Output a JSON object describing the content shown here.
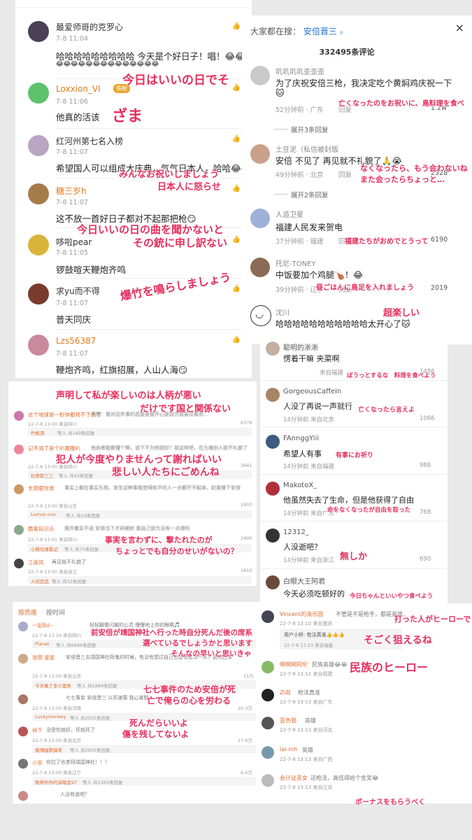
{
  "p1": {
    "comments": [
      {
        "name": "最爱师哥的克罗心",
        "time": "7-8 11:04",
        "body": "哈哈哈哈哈哈哈哈哈 今天是个好日子！唱！😂😂😂",
        "body2": "😂😂😂😂😂😂😂😂😂😂😂😂😂😂",
        "name_color": "#333"
      },
      {
        "name": "Loxxion_VI",
        "badge": "铁粉",
        "time": "7-8 11:06",
        "body": "他真的活该",
        "name_color": "#e07a1f"
      },
      {
        "name": "红河州第七名入榜",
        "time": "7-8 11:07",
        "body": "希望国人可以组成大庆典，气气日本人，哈哈😂😂",
        "name_color": "#333"
      },
      {
        "name": "糖三岁h",
        "time": "7-8 11:07",
        "body": "这不放一首好日子都对不起那把枪😏",
        "name_color": "#e07a1f"
      },
      {
        "name": "哆啦pear",
        "time": "7-8 11:05",
        "body": "锣鼓喧天鞭炮齐鸣",
        "name_color": "#333"
      },
      {
        "name": "求yu而不得",
        "time": "7-8 11:07",
        "body": "普天同庆",
        "name_color": "#333"
      },
      {
        "name": "Lzs56387",
        "time": "7-8 11:07",
        "body": "鞭炮齐鸣，红旗招展，人山人海😏",
        "name_color": "#e07a1f"
      }
    ]
  },
  "p2": {
    "search_label": "大家都在搜：",
    "search_term": "安倍晋三",
    "close": "×",
    "count": "332495条评论",
    "comments": [
      {
        "name": "叽叽叽叽歪歪歪",
        "body": "为了庆祝安倍三枪，我决定吃个黄焖鸡庆祝一下",
        "meta": "52分钟前 · 广东",
        "reply": "回复",
        "likes": "1.2w",
        "expand": "展开3条回复"
      },
      {
        "name": "土豆泥（私信被封版",
        "body": "安倍 不见了 再见就不礼貌了🙏😭",
        "meta": "49分钟前 · 北京",
        "reply": "回复",
        "likes": "2328",
        "expand": "展开2条回复"
      },
      {
        "name": "人造卫星",
        "body": "福建人民发来贺电",
        "meta": "37分钟前 · 福建",
        "reply": "回复",
        "likes": "6190"
      },
      {
        "name": "托尼-TONEY",
        "body": "中饭要加个鸡腿🍗！😂",
        "meta": "39分钟前 · 辽宁",
        "reply": "回复",
        "likes": "2019"
      },
      {
        "name": "沈川",
        "body": "哈哈哈哈哈哈哈哈哈哈哈太开心了🐱",
        "meta": "",
        "reply": "",
        "likes": ""
      }
    ]
  },
  "p3": {
    "comments": [
      {
        "name": "聪明的淅淅",
        "body": "愣着干嘛 夹菜啊",
        "meta": "来自福建",
        "likes": "1486"
      },
      {
        "name": "GorgeousCaffein",
        "body": "人没了再说一声就行",
        "meta": "14分钟前 来自北京",
        "likes": "1066"
      },
      {
        "name": "FAnnggYiii",
        "body": "希望人有事",
        "meta": "14分钟前 来自福建",
        "likes": "986"
      },
      {
        "name": "MakotoX_",
        "body": "他虽然失去了生命，但是他获得了自由",
        "meta": "14分钟前 来自广东",
        "likes": "768"
      },
      {
        "name": "12312_",
        "body": "人没逝吧？",
        "meta": "14分钟前 来自浙江",
        "likes": "690"
      },
      {
        "name": "白眼大王阿君",
        "body": "今天必须吃顿好的",
        "meta": "",
        "likes": ""
      }
    ]
  },
  "p4": {
    "rows": [
      {
        "name": "这个地球是一秒钟都将不下去了",
        "body": "声明：我对这件事的态度是我开心是因为我喜欢看到...",
        "time": "22-7-8 13:00 来自四川",
        "likes": "6376",
        "rep_name": "竹帆游",
        "rep_count": "等人 共169条回复"
      },
      {
        "name": "记不清了是个叭嗷嗷叭",
        "body": "他由者能都懂个啊，说下不为例就好？就这样吧，在为难别人就不礼貌了",
        "time": "22-7-8 13:00 来自四川",
        "likes": "3941",
        "rep_name": "拉蒂斯三三",
        "rep_count": "等人 共43条回复"
      },
      {
        "name": "长颈鹿你谁",
        "body": "事实上都在事实乐观，发生这种事我觉得和平的人一点都开不起来，赶紧搜下安倍",
        "time": "22-7-8 13:00 来自山东",
        "likes": "2903",
        "rep_name": "Lumos-ovo",
        "rep_count": "等人 共59条回复"
      },
      {
        "name": "酷客知识点",
        "body": "我开着实不说 安倍当下才碎被射 我自己就为没有一点错吗",
        "time": "22-7-8 13:01 来自四川",
        "likes": "2900",
        "rep_name": "小精功课看记",
        "rep_count": "等人 共75条回复"
      },
      {
        "name": "江南风",
        "body": "再见就不礼貌了",
        "time": "22-7-8 13:00 来自浙江",
        "likes": "1810",
        "rep_name": "人间百态",
        "rep_count": "等人 共52条回复"
      }
    ]
  },
  "p5": {
    "tabs": [
      "按热度",
      "按时间"
    ],
    "rows": [
      {
        "name": "一起Bd--",
        "body": "轻轻翻看闪耀的心灵 慢慢地上你的眼睛🎵",
        "time": "22-7-8 13:16 来自四川",
        "likes": "",
        "rep_name": "Planet",
        "rep_count": "等人 共6666条回复"
      },
      {
        "name": "张雨 星星",
        "body": "安倍晋三去靖国神社拜鬼的时候，有没有想过自己也会有这么一天？说明日本",
        "time": "22-7-8 13:00 来自山东",
        "likes": "11万",
        "rep_name": "今天做了多少面条",
        "rep_count": "等人 共1889条回复"
      },
      {
        "name": "",
        "body": "七七事变 安倍晋三 以死谢罪 我心甚慰",
        "time": "22-7-8 13:00 来自河南",
        "likes": "20.3万",
        "rep_name": "Luckymonkey",
        "rep_count": "等人 共2035条回复"
      },
      {
        "name": "林下",
        "body": "没受伤就好，死就死了",
        "time": "22-7-8 13:00 来自北京",
        "likes": "17.6万",
        "rep_name": "微博幽默搞笑",
        "rep_count": "等人 共2805条回复"
      },
      {
        "name": "小安",
        "body": "你拉了也参拜靖国神社！！！",
        "time": "22-7-8 13:00 来自辽宁",
        "likes": "6.5万",
        "rep_name": "致来听你的演唱会97",
        "rep_count": "等人 共1365条回复"
      },
      {
        "name": "",
        "body": "人没有逝吧？",
        "time": "",
        "likes": "",
        "rep_name": "",
        "rep_count": ""
      }
    ]
  },
  "p6": {
    "rows": [
      {
        "name": "Vincent的海乐园",
        "body": "不管是不是枪手，都是英雄，",
        "time": "22-7-8 13:10 来自重庆",
        "rep": "用户小桥: 枪法真准👍👍👍",
        "rep_time": "22-7-8 13:23 来自福建"
      },
      {
        "name": "啊啊啊阿伦",
        "body": "民族英雄😂😂",
        "time": "22-7-8 13:12 来自福建"
      },
      {
        "name": "Zi尚",
        "body": "枪法真准",
        "time": "22-7-8 13:13 来自广东"
      },
      {
        "name": "亚色我",
        "body": "英雄",
        "time": "22-7-8 13:13 来自河北"
      },
      {
        "name": "lai-mh",
        "body": "英雄",
        "time": "22-7-8 13:13 来自广西"
      },
      {
        "name": "会计证恶女",
        "body": "这枪法，高低得给个金奖😂",
        "time": "22-7-8 13:13 来自江苏"
      }
    ]
  },
  "annotations": {
    "a1": "今日はいいの日でそ",
    "a2": "ざま",
    "a3": "みんなお祝いしましょう",
    "a4": "日本人に怒らせ",
    "a5": "今日いいの日の曲を聞かないと",
    "a6": "その銃に申し訳ない",
    "a7": "爆竹を鳴らしましょう",
    "b1": "亡くなったのをお祝いに、鳥料理を食べ",
    "b2": "なくなったら、もう会わないね",
    "b3": "また会ったらちょっと…",
    "b4": "福建たちがおめでとうって",
    "b5": "昼ごはんに鳥足を入れましょう",
    "b6": "超楽しい",
    "c1": "ぼうっとするな　料理を食べよう",
    "c2": "亡くなったら言えよ",
    "c3": "有事にお祈り",
    "c4": "命をなくなったが自由を取った",
    "c5": "無しか",
    "c6": "今日ちゃんといいやつ食べよう",
    "d1": "声明して私が楽しいのは人柄が悪い",
    "d2": "だけです国と関係ない",
    "d3": "犯人が今度やりませんって謝ればいい",
    "d4": "悲しい人たちにごめんね",
    "d5": "事実を言わずに、撃たれたのが",
    "d6": "ちょっとでも自分のせいがないの？",
    "e1": "前安倍が靖国神社へ行った時自分死んだ後の席系",
    "e2": "選べているでしょうかと思います",
    "e3": "そんなの早いと思いきゃ",
    "e4": "七七事件のため安倍が死",
    "e5": "亡で俺らの心を労わる",
    "e6": "死んだらいいよ",
    "e7": "傷を残してないよ",
    "f1": "打った人がヒーローで",
    "f2": "そごく狙えるね",
    "f3": "民族のヒーロー",
    "f4": "ボーナスをもらうべく"
  },
  "colors": {
    "annotation": "#e62f5e",
    "vip_name": "#e07a1f",
    "link": "#1f6fd1"
  }
}
